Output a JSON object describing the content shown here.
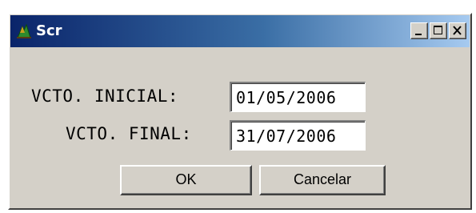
{
  "window": {
    "title": "Scr",
    "controls": {
      "minimize_icon": "minimize-icon",
      "maximize_icon": "maximize-icon",
      "close_icon": "close-icon"
    }
  },
  "form": {
    "vcto_inicial_label": "VCTO. INICIAL:",
    "vcto_inicial_value": "01/05/2006",
    "vcto_final_label": "VCTO. FINAL:",
    "vcto_final_value": "31/07/2006"
  },
  "buttons": {
    "ok_label": "OK",
    "cancel_label": "Cancelar"
  },
  "colors": {
    "titlebar_start": "#0a246a",
    "titlebar_end": "#a6caf0",
    "window_bg": "#d4d0c8"
  }
}
